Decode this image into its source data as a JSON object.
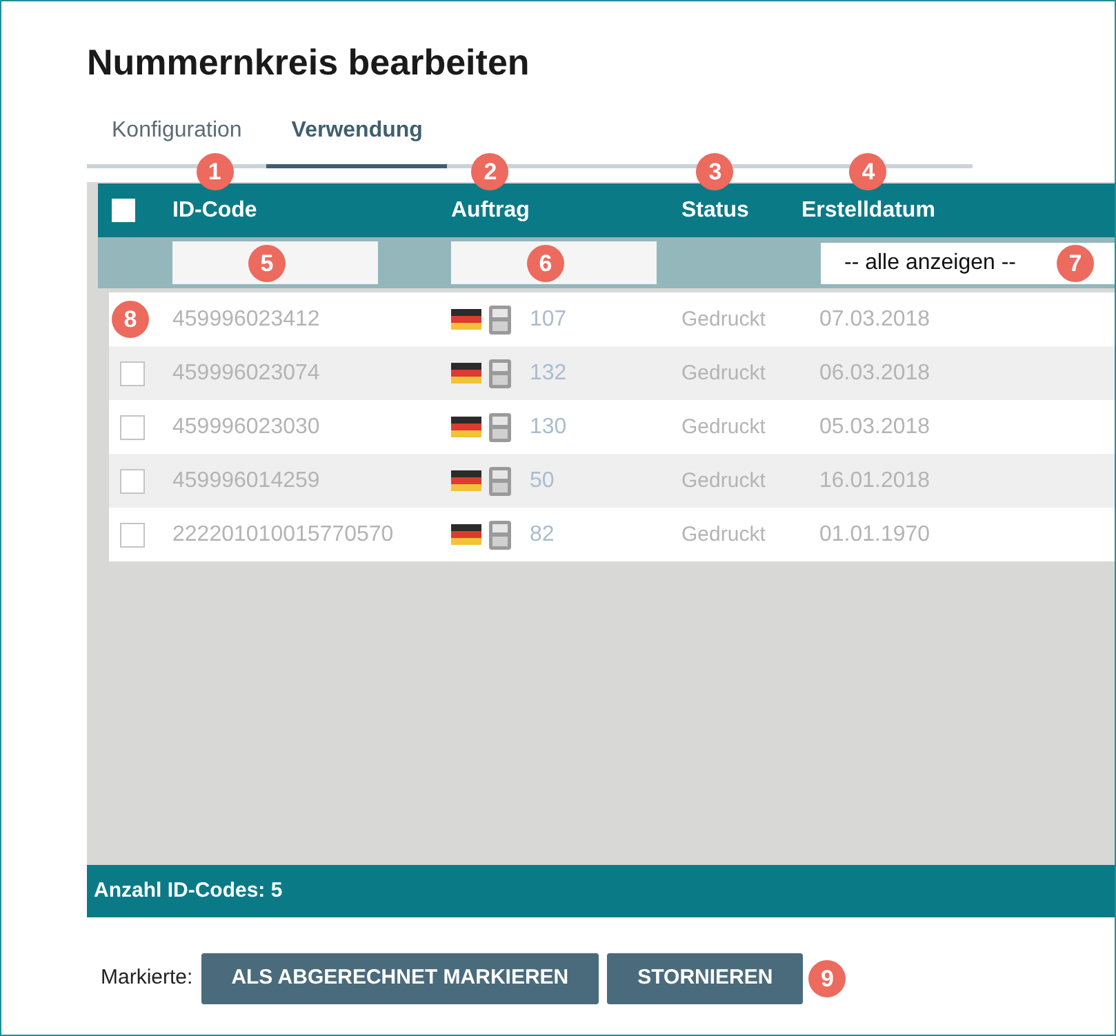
{
  "title": "Nummernkreis bearbeiten",
  "tabs": [
    {
      "label": "Konfiguration",
      "selected": false
    },
    {
      "label": "Verwendung",
      "selected": true
    }
  ],
  "table": {
    "select_all": {
      "checked": false
    },
    "columns": [
      {
        "label": "ID-Code",
        "marker": "1"
      },
      {
        "label": "Auftrag",
        "marker": "2"
      },
      {
        "label": "Status",
        "marker": "3"
      },
      {
        "label": "Erstelldatum",
        "marker": "4"
      }
    ],
    "filters": [
      {
        "kind": "text",
        "marker": "5"
      },
      {
        "kind": "text",
        "marker": "6"
      },
      {
        "kind": "empty"
      },
      {
        "kind": "select",
        "value": "-- alle anzeigen --",
        "marker": "7"
      }
    ],
    "rows": [
      {
        "marker": "8",
        "id_code": "459996023412",
        "order": "107",
        "status": "Gedruckt",
        "created": "07.03.2018"
      },
      {
        "checked": false,
        "id_code": "459996023074",
        "order": "132",
        "status": "Gedruckt",
        "created": "06.03.2018"
      },
      {
        "checked": false,
        "id_code": "459996023030",
        "order": "130",
        "status": "Gedruckt",
        "created": "05.03.2018"
      },
      {
        "checked": false,
        "id_code": "459996014259",
        "order": "50",
        "status": "Gedruckt",
        "created": "16.01.2018"
      },
      {
        "checked": false,
        "id_code": "222201010015770570",
        "order": "82",
        "status": "Gedruckt",
        "created": "01.01.1970"
      }
    ]
  },
  "footer": {
    "count": "Anzahl ID-Codes: 5"
  },
  "actions": {
    "label": "Markierte:",
    "buttons": [
      {
        "label": "ALS ABGERECHNET MARKIEREN"
      },
      {
        "label": "STORNIEREN",
        "marker": "9"
      }
    ]
  }
}
